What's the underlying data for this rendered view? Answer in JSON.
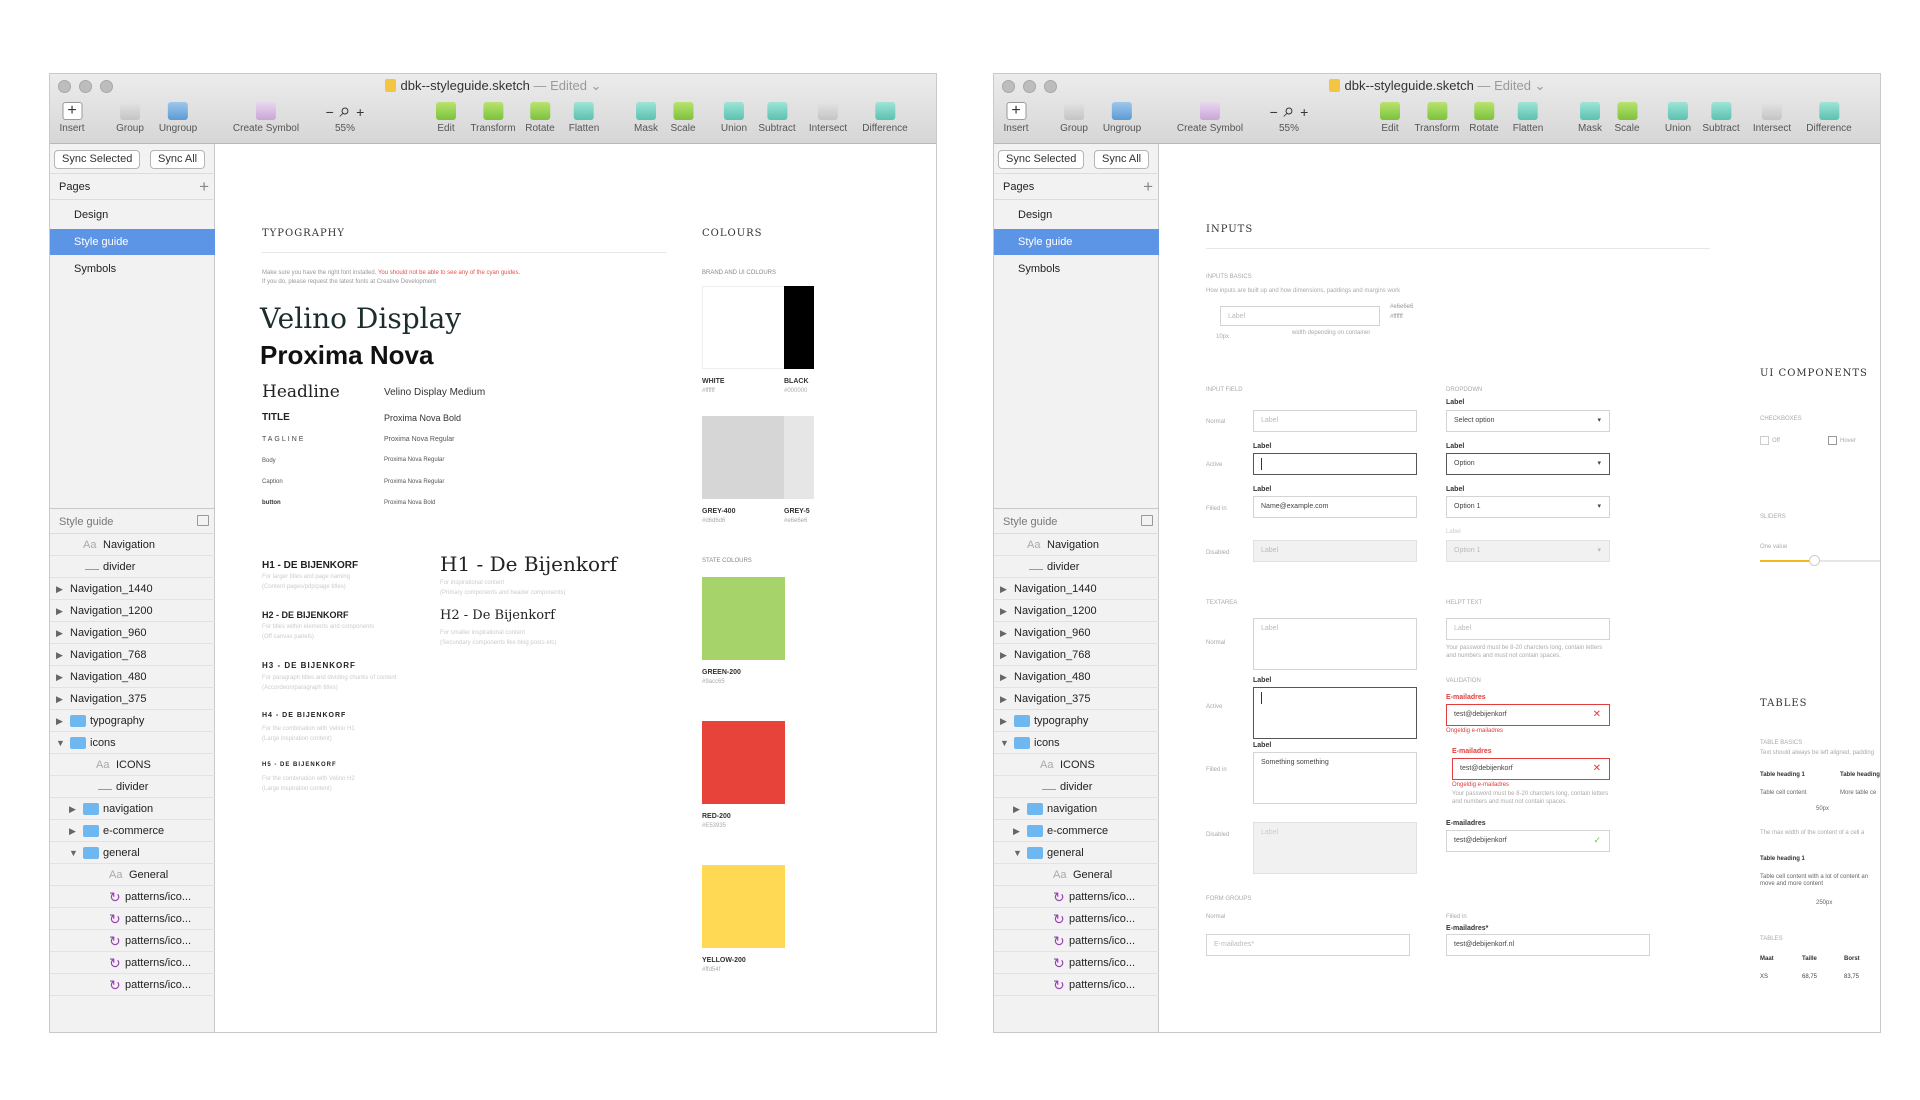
{
  "toolbar": {
    "insert": "Insert",
    "group": "Group",
    "ungroup": "Ungroup",
    "create_symbol": "Create Symbol",
    "zoom_minus": "−",
    "zoom_plus": "+",
    "zoom": "55%",
    "edit": "Edit",
    "transform": "Transform",
    "rotate": "Rotate",
    "flatten": "Flatten",
    "mask": "Mask",
    "scale": "Scale",
    "union": "Union",
    "subtract": "Subtract",
    "intersect": "Intersect",
    "difference": "Difference"
  },
  "window": {
    "title": "dbk--styleguide.sketch",
    "edited": "— Edited ⌄"
  },
  "sidebar": {
    "sync_selected": "Sync Selected",
    "sync_all": "Sync All",
    "pages_label": "Pages",
    "add_page": "+",
    "pages": [
      "Design",
      "Style guide",
      "Symbols"
    ],
    "layers_header": "Style guide",
    "layers": [
      {
        "label": "Navigation",
        "kind": "text"
      },
      {
        "label": "divider",
        "kind": "line"
      },
      {
        "label": "Navigation_1440",
        "kind": "group"
      },
      {
        "label": "Navigation_1200",
        "kind": "group"
      },
      {
        "label": "Navigation_960",
        "kind": "group"
      },
      {
        "label": "Navigation_768",
        "kind": "group"
      },
      {
        "label": "Navigation_480",
        "kind": "group"
      },
      {
        "label": "Navigation_375",
        "kind": "group"
      },
      {
        "label": "typography",
        "kind": "folder"
      },
      {
        "label": "icons",
        "kind": "folder-open"
      },
      {
        "label": "ICONS",
        "kind": "text"
      },
      {
        "label": "divider",
        "kind": "line"
      },
      {
        "label": "navigation",
        "kind": "folder"
      },
      {
        "label": "e-commerce",
        "kind": "folder"
      },
      {
        "label": "general",
        "kind": "folder-open"
      },
      {
        "label": "General",
        "kind": "text"
      },
      {
        "label": "patterns/ico...",
        "kind": "symbol"
      },
      {
        "label": "patterns/ico...",
        "kind": "symbol"
      },
      {
        "label": "patterns/ico...",
        "kind": "symbol"
      },
      {
        "label": "patterns/ico...",
        "kind": "symbol"
      },
      {
        "label": "patterns/ico...",
        "kind": "symbol"
      }
    ]
  },
  "typography": {
    "title": "TYPOGRAPHY",
    "note1": "Make sure you have the right font installed.",
    "note_red": "You should not be able to see any of the cyan guides.",
    "note2": "If you do, please request the latest fonts at Creative Development",
    "display1": "Velino Display",
    "display2": "Proxima Nova",
    "specs": [
      {
        "name": "Headline",
        "font": "Velino Display Medium"
      },
      {
        "name": "TITLE",
        "font": "Proxima Nova Bold"
      },
      {
        "name": "TAGLINE",
        "font": "Proxima Nova Regular"
      },
      {
        "name": "Body",
        "font": "Proxima Nova Regular"
      },
      {
        "name": "Caption",
        "font": "Proxima Nova Regular"
      },
      {
        "name": "button",
        "font": "Proxima Nova Bold"
      }
    ],
    "headings_left": [
      {
        "t": "H1 - DE BIJENKORF",
        "d1": "For larger titles and page naming",
        "d2": "(Content pages/pdp/page titles)"
      },
      {
        "t": "H2 - DE BIJENKORF",
        "d1": "For titles within elements and components",
        "d2": "(Off canvas panels)"
      },
      {
        "t": "H3 - DE BIJENKORF",
        "d1": "For paragraph titles and dividing chunks of content",
        "d2": "(Accordeon/paragraph titles)"
      },
      {
        "t": "H4 - DE BIJENKORF",
        "d1": "For the combination with Velino H1",
        "d2": "(Large inspiration content)"
      },
      {
        "t": "H5 - DE BIJENKORF",
        "d1": "For the combination with Velino H2",
        "d2": "(Large inspiration content)"
      }
    ],
    "headings_right": [
      {
        "t": "H1 - De Bijenkorf",
        "d1": "For inspirational content",
        "d2": "(Primary components and header components)"
      },
      {
        "t": "H2 - De Bijenkorf",
        "d1": "For smaller inspirational content",
        "d2": "(Secundary components like blog posts etc)"
      }
    ]
  },
  "colours": {
    "title": "COLOURS",
    "brand_label": "BRAND AND UI COLOURS",
    "state_label": "STATE COLOURS",
    "brand": [
      {
        "name": "WHITE",
        "hex": "#ffffff",
        "color": "#ffffff"
      },
      {
        "name": "BLACK",
        "hex": "#000000",
        "color": "#000000"
      },
      {
        "name": "GREY-400",
        "hex": "#d6d6d6",
        "color": "#d6d6d6"
      },
      {
        "name": "GREY-5",
        "hex": "#e6e6e6",
        "color": "#e6e6e6"
      }
    ],
    "state": [
      {
        "name": "GREEN-200",
        "hex": "#9acc65",
        "color": "#a6d46a"
      },
      {
        "name": "RED-200",
        "hex": "#E53935",
        "color": "#e8433b"
      },
      {
        "name": "YELLOW-200",
        "hex": "#ffd54f",
        "color": "#ffd954"
      }
    ]
  },
  "inputs": {
    "title": "INPUTS",
    "basics_label": "INPUTS BASICS",
    "basics_desc": "How inputs are built up and how dimensions, paddings and margins work",
    "basic_placeholder": "Label",
    "hex_a": "#e6e6e6",
    "hex_b": "#ffffff",
    "dim_px": "10px",
    "dim_width": "width depending on container",
    "field_label": "INPUT FIELD",
    "dropdown_label": "DROPDOWN",
    "states": {
      "normal": "Normal",
      "active": "Active",
      "filled": "Filled in",
      "disabled": "Disabled"
    },
    "field_lbl": "Label",
    "f_normal": "Label",
    "f_filled": "Name@example.com",
    "f_disabled": "Label",
    "d_normal": "Select option",
    "d_active": "Option",
    "d_filled": "Option 1",
    "d_disabled": "Option 1",
    "caret": "▾",
    "textarea_label": "TEXTAREA",
    "helper_label": "HELPT TEXT",
    "t_normal": "Label",
    "t_filled": "Something something",
    "t_disabled": "Label",
    "helper_ph": "Label",
    "helper_text": "Your password must be 8-20 charcters long, contain letters and numbers and must not contain spaces.",
    "validation_label": "VALIDATION",
    "email_label": "E-mailadres",
    "email_err": "test@debijenkorf",
    "err_msg": "Ongeldig e-mailadres",
    "err_x": "✕",
    "ok": "✓",
    "form_groups": "FORM GROUPS",
    "fg_normal": "Normal",
    "fg_filled": "Filled in",
    "fg_ph": "E-mailadres*",
    "fg_label": "E-mailadres*",
    "fg_value": "test@debijenkorf.nl"
  },
  "ui_components": {
    "title": "UI COMPONENTS",
    "checkboxes": "CHECKBOXES",
    "off": "Off",
    "hover": "Hover",
    "sliders": "SLIDERS",
    "one_value": "One value",
    "slider_value": 0.45
  },
  "tables": {
    "title": "TABLES",
    "basics": "TABLE BASICS",
    "basics_desc": "Text should always be left aligned, padding",
    "h1": "Table heading 1",
    "h2": "Table heading",
    "c1": "Table cell content",
    "c2": "More table ce",
    "px50": "50px",
    "note": "The max width of the content of a cell a",
    "h3": "Table heading 1",
    "c3": "Table cell content with a lot of content an move and more content",
    "px200": "250px",
    "tables_label": "TABLES",
    "cols": [
      "Maat",
      "Taille",
      "Borst"
    ],
    "row": [
      "XS",
      "68,75",
      "83,75"
    ]
  }
}
